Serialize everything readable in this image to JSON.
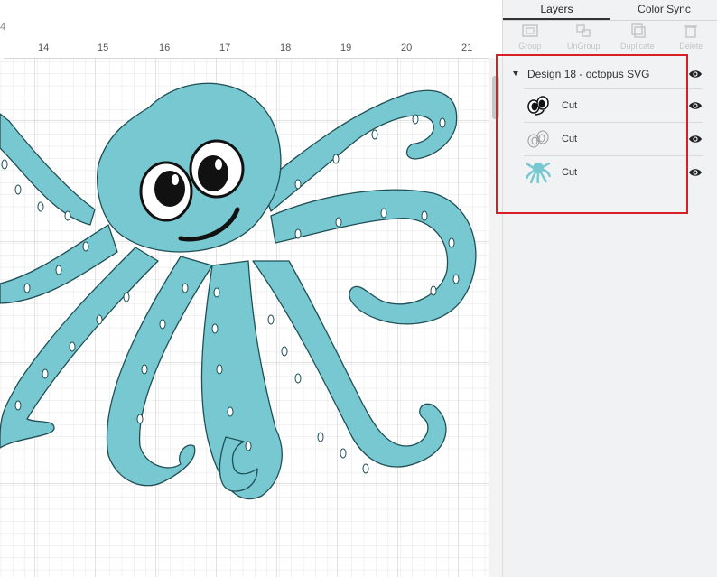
{
  "ruler": {
    "marks": [
      "14",
      "15",
      "16",
      "17",
      "18",
      "19",
      "20",
      "21"
    ],
    "left_marks": [
      "4"
    ]
  },
  "tabs": [
    {
      "label": "Layers",
      "active": true
    },
    {
      "label": "Color Sync",
      "active": false
    }
  ],
  "toolbar": [
    {
      "label": "Group",
      "icon": "group-icon"
    },
    {
      "label": "UnGroup",
      "icon": "ungroup-icon"
    },
    {
      "label": "Duplicate",
      "icon": "duplicate-icon"
    },
    {
      "label": "Delete",
      "icon": "delete-icon"
    }
  ],
  "layers": {
    "group_title": "Design 18 - octopus SVG",
    "items": [
      {
        "label": "Cut",
        "thumb": "eyes-thumb"
      },
      {
        "label": "Cut",
        "thumb": "eye-outline-thumb"
      },
      {
        "label": "Cut",
        "thumb": "octopus-thumb"
      }
    ]
  },
  "colors": {
    "octopus": "#78c8d2",
    "outline": "#1f4f55",
    "highlight_box": "#d81f26",
    "grid": "#e3e3e3",
    "grid_major": "#c9c9c9"
  }
}
